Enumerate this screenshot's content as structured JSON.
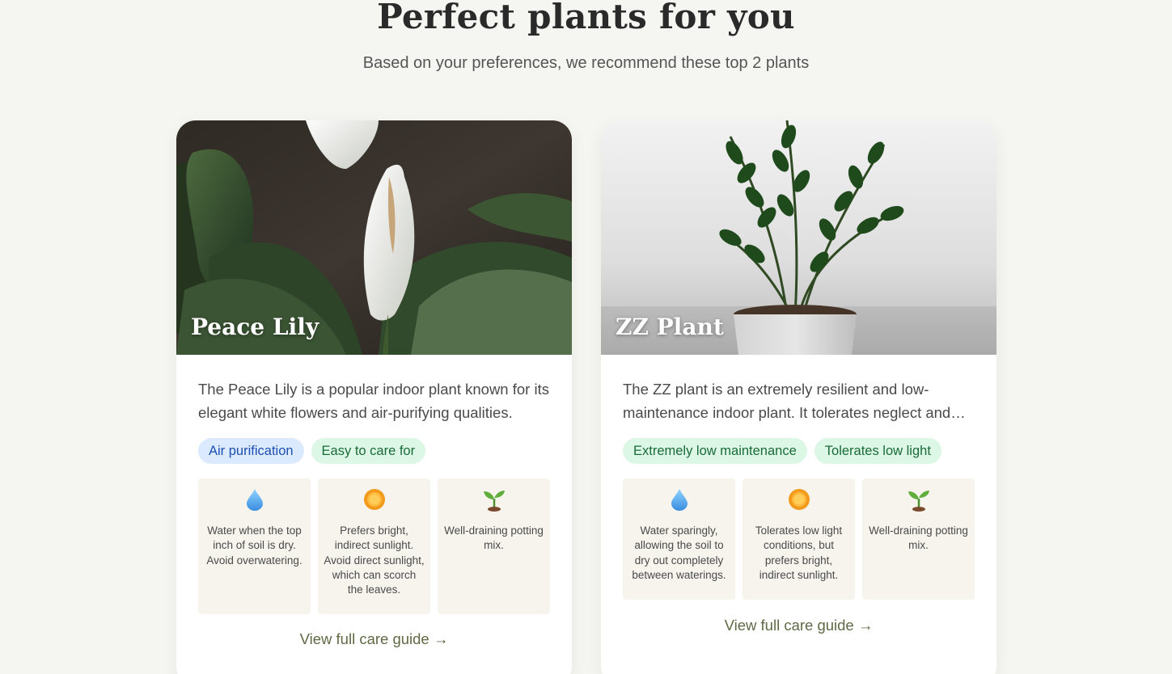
{
  "header": {
    "title": "Perfect plants for you",
    "subtitle": "Based on your preferences, we recommend these top 2 plants"
  },
  "plants": [
    {
      "name": "Peace Lily",
      "description": "The Peace Lily is a popular indoor plant known for its elegant white flowers and air-purifying qualities.",
      "tags": [
        {
          "label": "Air purification",
          "color": "#dbeafe"
        },
        {
          "label": "Easy to care for",
          "color": "#dcf7e6"
        }
      ],
      "care": [
        {
          "icon": "water-drop-icon",
          "text": "Water when the top inch of soil is dry. Avoid overwatering."
        },
        {
          "icon": "sun-icon",
          "text": "Prefers bright, indirect sunlight. Avoid direct sunlight, which can scorch the leaves."
        },
        {
          "icon": "seedling-icon",
          "text": "Well-draining potting mix."
        }
      ],
      "link": "View full care guide →"
    },
    {
      "name": "ZZ Plant",
      "description": "The ZZ plant is an extremely resilient and low-maintenance indoor plant. It tolerates neglect and low light.",
      "tags": [
        {
          "label": "Extremely low maintenance",
          "color": "#dcf7e6"
        },
        {
          "label": "Tolerates low light",
          "color": "#dcf7e6"
        }
      ],
      "care": [
        {
          "icon": "water-drop-icon",
          "text": "Water sparingly, allowing the soil to dry out completely between waterings."
        },
        {
          "icon": "sun-icon",
          "text": "Tolerates low light conditions, but prefers bright, indirect sunlight."
        },
        {
          "icon": "seedling-icon",
          "text": "Well-draining potting mix."
        }
      ],
      "link": "View full care guide →"
    }
  ],
  "colors": {
    "background": "#f5f5f2",
    "card": "#ffffff",
    "care_box": "#f7f4ee",
    "link": "#5e6a45"
  }
}
